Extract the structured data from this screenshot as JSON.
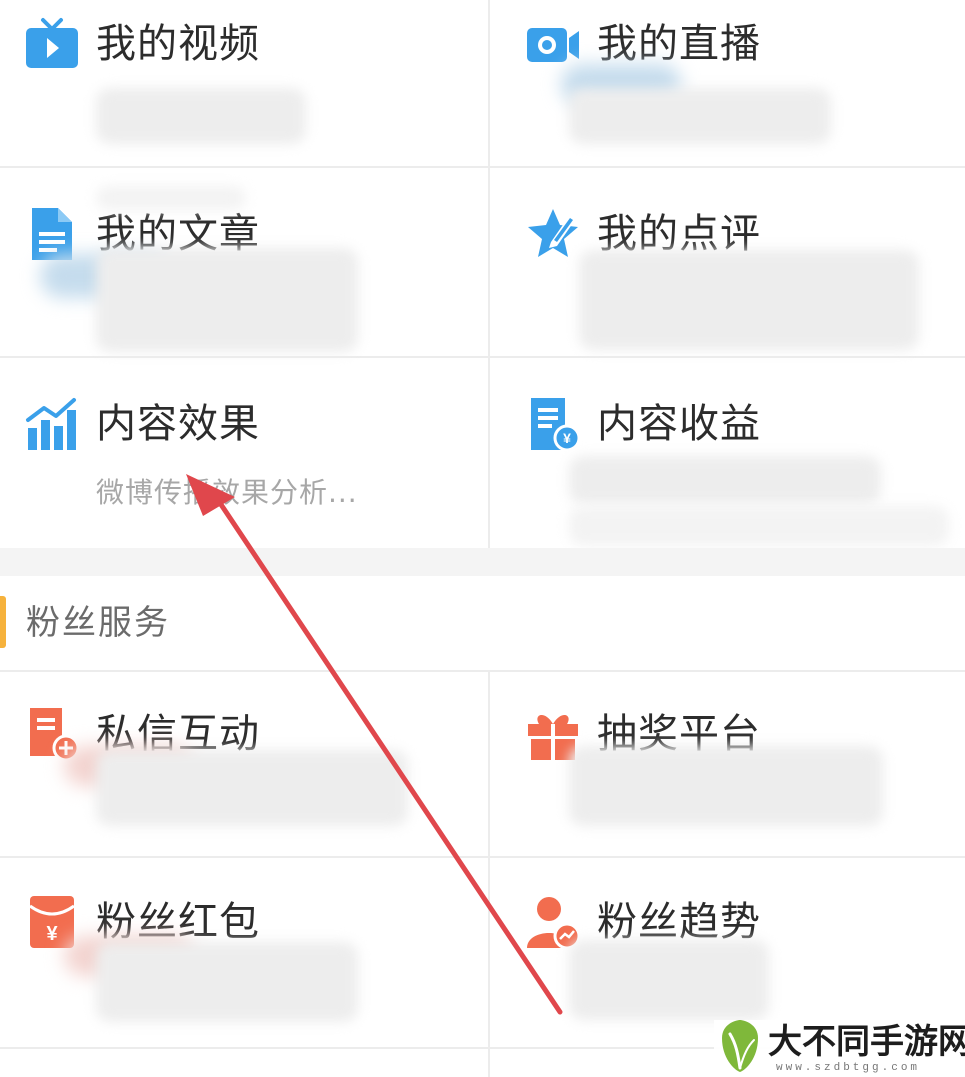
{
  "creator_services": {
    "items": [
      {
        "title": "我的视频",
        "icon": "tv-icon",
        "color": "#3aa0ea"
      },
      {
        "title": "我的直播",
        "icon": "camera-icon",
        "color": "#3aa0ea"
      },
      {
        "title": "我的文章",
        "icon": "document-icon",
        "color": "#3aa0ea"
      },
      {
        "title": "我的点评",
        "icon": "star-pen-icon",
        "color": "#3aa0ea"
      },
      {
        "title": "内容效果",
        "subtitle": "微博传播效果分析...",
        "icon": "bar-chart-icon",
        "color": "#3aa0ea"
      },
      {
        "title": "内容收益",
        "icon": "income-document-icon",
        "color": "#3aa0ea"
      }
    ]
  },
  "fan_services": {
    "title": "粉丝服务",
    "accent_color": "#f6b23c",
    "items": [
      {
        "title": "私信互动",
        "icon": "message-document-icon",
        "color": "#f26d4f"
      },
      {
        "title": "抽奖平台",
        "icon": "gift-icon",
        "color": "#f26d4f"
      },
      {
        "title": "粉丝红包",
        "icon": "red-envelope-icon",
        "color": "#f26d4f"
      },
      {
        "title": "粉丝趋势",
        "icon": "user-trend-icon",
        "color": "#f26d4f"
      }
    ]
  },
  "annotation": {
    "arrow_color": "#e0474c"
  },
  "watermark": {
    "text": "大不同手游网",
    "url": "www.szdbtgg.com"
  }
}
